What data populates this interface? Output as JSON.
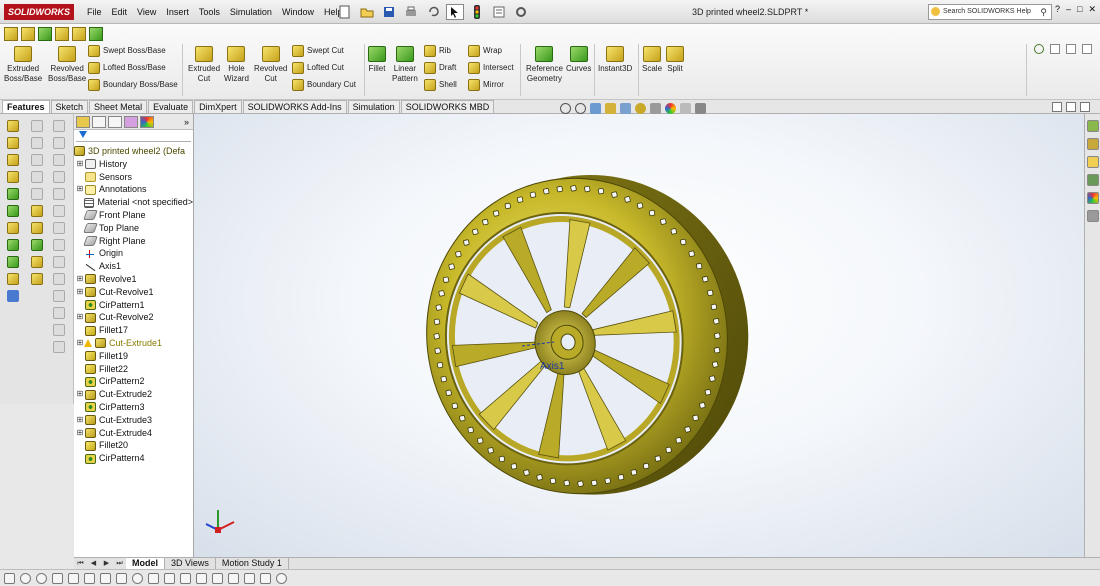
{
  "app": {
    "brand": "SOLIDWORKS"
  },
  "menu": [
    "File",
    "Edit",
    "View",
    "Insert",
    "Tools",
    "Simulation",
    "Window",
    "Help"
  ],
  "document_title": "3D printed wheel2.SLDPRT *",
  "help_search": {
    "placeholder": "Search SOLIDWORKS Help"
  },
  "commands": {
    "extruded_boss": [
      "Extruded",
      "Boss/Base"
    ],
    "revolved_boss": [
      "Revolved",
      "Boss/Base"
    ],
    "swept_boss": "Swept Boss/Base",
    "lofted_boss": "Lofted Boss/Base",
    "boundary_boss": "Boundary Boss/Base",
    "extruded_cut": [
      "Extruded",
      "Cut"
    ],
    "hole_wizard": [
      "Hole",
      "Wizard"
    ],
    "revolved_cut": [
      "Revolved",
      "Cut"
    ],
    "swept_cut": "Swept Cut",
    "lofted_cut": "Lofted Cut",
    "boundary_cut": "Boundary Cut",
    "fillet": "Fillet",
    "linear_pattern": [
      "Linear",
      "Pattern"
    ],
    "rib": "Rib",
    "draft": "Draft",
    "shell": "Shell",
    "wrap": "Wrap",
    "intersect": "Intersect",
    "mirror": "Mirror",
    "reference_geometry": [
      "Reference",
      "Geometry"
    ],
    "curves": "Curves",
    "instant3d": "Instant3D",
    "scale": "Scale",
    "split": "Split"
  },
  "tabs": [
    "Features",
    "Sketch",
    "Sheet Metal",
    "Evaluate",
    "DimXpert",
    "SOLIDWORKS Add-Ins",
    "Simulation",
    "SOLIDWORKS MBD"
  ],
  "active_tab": "Features",
  "tree": {
    "root": "3D printed wheel2  (Defa",
    "items": [
      {
        "label": "History",
        "expand": true,
        "icon": "history-icon"
      },
      {
        "label": "Sensors",
        "expand": false,
        "icon": "sensor-icon"
      },
      {
        "label": "Annotations",
        "expand": true,
        "icon": "annotation-icon"
      },
      {
        "label": "Material <not specified>",
        "expand": false,
        "icon": "material-icon"
      },
      {
        "label": "Front Plane",
        "expand": false,
        "icon": "plane-icon"
      },
      {
        "label": "Top Plane",
        "expand": false,
        "icon": "plane-icon"
      },
      {
        "label": "Right Plane",
        "expand": false,
        "icon": "plane-icon"
      },
      {
        "label": "Origin",
        "expand": false,
        "icon": "origin-icon"
      },
      {
        "label": "Axis1",
        "expand": false,
        "icon": "axis-icon"
      },
      {
        "label": "Revolve1",
        "expand": true,
        "icon": "revolve-icon"
      },
      {
        "label": "Cut-Revolve1",
        "expand": true,
        "icon": "cut-revolve-icon"
      },
      {
        "label": "CirPattern1",
        "expand": false,
        "icon": "circular-pattern-icon"
      },
      {
        "label": "Cut-Revolve2",
        "expand": true,
        "icon": "cut-revolve-icon"
      },
      {
        "label": "Fillet17",
        "expand": false,
        "icon": "fillet-icon"
      },
      {
        "label": "Cut-Extrude1",
        "expand": true,
        "icon": "cut-extrude-icon",
        "warning": true
      },
      {
        "label": "Fillet19",
        "expand": false,
        "icon": "fillet-icon"
      },
      {
        "label": "Fillet22",
        "expand": false,
        "icon": "fillet-icon"
      },
      {
        "label": "CirPattern2",
        "expand": false,
        "icon": "circular-pattern-icon"
      },
      {
        "label": "Cut-Extrude2",
        "expand": true,
        "icon": "cut-extrude-icon"
      },
      {
        "label": "CirPattern3",
        "expand": false,
        "icon": "circular-pattern-icon"
      },
      {
        "label": "Cut-Extrude3",
        "expand": true,
        "icon": "cut-extrude-icon"
      },
      {
        "label": "Cut-Extrude4",
        "expand": true,
        "icon": "cut-extrude-icon"
      },
      {
        "label": "Fillet20",
        "expand": false,
        "icon": "fillet-icon"
      },
      {
        "label": "CirPattern4",
        "expand": false,
        "icon": "circular-pattern-icon"
      }
    ]
  },
  "viewport": {
    "axis_label": "Axis1",
    "model_color": "#c8b92a"
  },
  "bottom_tabs": [
    "Model",
    "3D Views",
    "Motion Study 1"
  ],
  "active_bottom_tab": "Model",
  "colors": {
    "brand_red": "#b3121b",
    "warning": "#f0b800",
    "selection_blue": "#1a3aa8"
  }
}
